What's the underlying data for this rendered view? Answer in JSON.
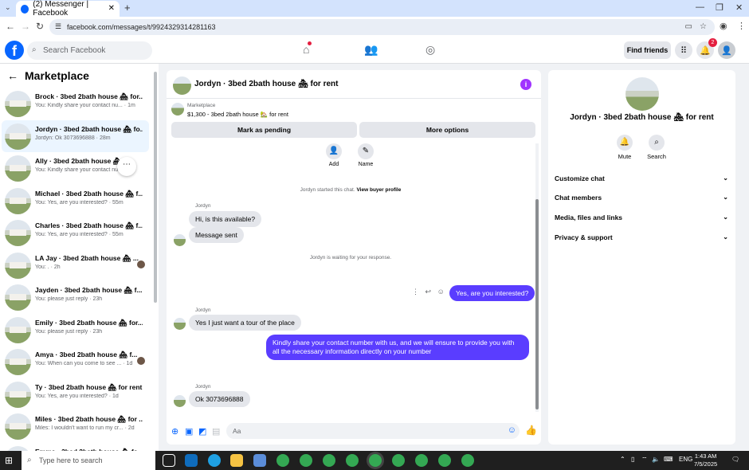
{
  "browser": {
    "tab_title": "(2) Messenger | Facebook",
    "url": "facebook.com/messages/t/9924329314281163"
  },
  "fb": {
    "search_placeholder": "Search Facebook",
    "find_friends": "Find friends",
    "notif_count": "2"
  },
  "sidebar": {
    "title": "Marketplace",
    "threads": [
      {
        "name": "Brock · 3bed 2bath house 🏘 for...",
        "preview": "You: Kindly share your contact nu... · 1m"
      },
      {
        "name": "Jordyn · 3bed 2bath house 🏘 fo...",
        "preview": "Jordyn: Ok 3073696888 · 28m"
      },
      {
        "name": "Ally · 3bed 2bath house 🏘 fo...",
        "preview": "You: Kindly share your contact nu..."
      },
      {
        "name": "Michael · 3bed 2bath house 🏘 f...",
        "preview": "You: Yes, are you interested? · 55m"
      },
      {
        "name": "Charles · 3bed 2bath house 🏘 f...",
        "preview": "You: Yes, are you interested? · 55m"
      },
      {
        "name": "LA Jay · 3bed 2bath house 🏘 ...",
        "preview": "You: . · 2h"
      },
      {
        "name": "Jayden · 3bed 2bath house 🏘 f...",
        "preview": "You: please just reply · 23h"
      },
      {
        "name": "Emily · 3bed 2bath house 🏘 for...",
        "preview": "You: please just reply · 23h"
      },
      {
        "name": "Amya · 3bed 2bath house 🏘 f...",
        "preview": "You: When can you come to see ... · 1d"
      },
      {
        "name": "Ty · 3bed 2bath house 🏘 for rent",
        "preview": "You: Yes, are you interested? · 1d"
      },
      {
        "name": "Miles · 3bed 2bath house 🏘 for ...",
        "preview": "Miles: I wouldn't want to run my cr... · 2d"
      },
      {
        "name": "Emma · 3bed 2bath house 🏘 fo...",
        "preview": ""
      }
    ]
  },
  "chat": {
    "title": "Jordyn · 3bed 2bath house 🏘 for rent",
    "marketplace_label": "Marketplace",
    "listing": "$1,300 - 3bed 2bath house 🏡 for rent",
    "mark_pending": "Mark as pending",
    "more_options": "More options",
    "actions": [
      {
        "label": "Add"
      },
      {
        "label": "Name"
      }
    ],
    "started": "Jordyn started this chat.",
    "view_profile": "View buyer profile",
    "sender": "Jordyn",
    "msg1": "Hi, is this available?",
    "msg2": "Message sent",
    "waiting": "Jordyn is waiting for your response.",
    "out1": "Yes, are you interested?",
    "msg3": "Yes I just want a tour of the place",
    "out2": "Kindly share your contact number with us, and we will ensure to provide you with all the necessary information directly on your number",
    "msg4": "Ok 3073696888",
    "composer_placeholder": "Aa"
  },
  "details": {
    "title": "Jordyn · 3bed 2bath house 🏘 for rent",
    "actions": [
      {
        "label": "Mute"
      },
      {
        "label": "Search"
      }
    ],
    "sections": [
      "Customize chat",
      "Chat members",
      "Media, files and links",
      "Privacy & support"
    ]
  },
  "taskbar": {
    "search_placeholder": "Type here to search",
    "lang": "ENG",
    "time": "1:43 AM",
    "date": "7/5/2025"
  },
  "colors": {
    "fb_blue": "#0866ff",
    "outgoing": "#5a3dff",
    "selected": "#ebf5ff"
  }
}
